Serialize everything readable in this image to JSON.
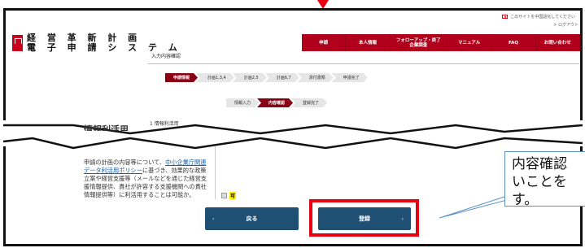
{
  "header": {
    "topline": "このサイトを中国語化してください",
    "logout": "ログアウト",
    "logo_line1": "経 営 革 新 計 画",
    "logo_line2": "電 子 申 請 シ ス テ ム",
    "nav": [
      "申請",
      "本人情報",
      "フォローアップ・終了\n企業調査",
      "マニュアル",
      "FAQ",
      "お問い合わせ"
    ]
  },
  "main": {
    "section_title": "入力内容確認",
    "steps": [
      "申請情報",
      "計画1,3,4",
      "計画2,5",
      "計画6,7",
      "添付書類",
      "申請完了"
    ],
    "substeps": [
      "情報入力",
      "内容確認",
      "登録完了"
    ],
    "side_label": "情報利活用",
    "side_label2": "1 情報利活用",
    "policy_text_1": "申請の計画の内容等について、",
    "policy_link": "中小企業庁関連データ利活用ポリシー",
    "policy_text_2": "に基づき、効果的な政策立案や経営支援等（メールなどを通じた経営支援情報提供、貴社が許容する支援機関への貴社情報提供等）に利活用することは可能か。",
    "agree_label": "可",
    "back_button": "戻る",
    "register_button": "登録"
  },
  "callout": {
    "text": "内容確認\nいことを\nす。"
  },
  "colors": {
    "nav_bg": "#b1001c",
    "button_bg": "#1f4f73",
    "highlight": "#e60012",
    "callout_border": "#5b8fc7"
  }
}
